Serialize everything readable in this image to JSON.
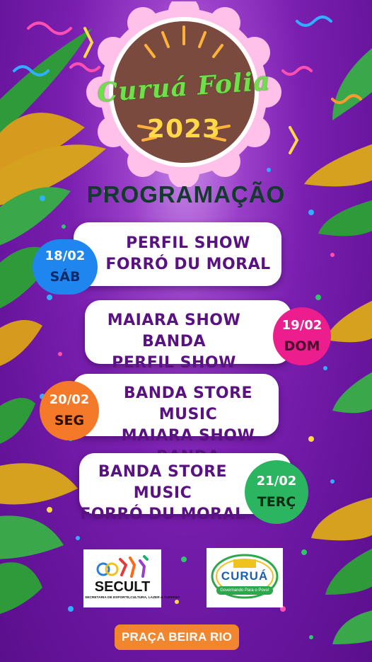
{
  "event": {
    "title": "Curuá Folia",
    "year": "2023"
  },
  "section_title": "PROGRAMAÇÃO",
  "schedule": [
    {
      "date": "18/02",
      "weekday": "SÁB",
      "lines": [
        "PERFIL SHOW",
        "FORRÓ DU MORAL"
      ],
      "color": "#1e86ee"
    },
    {
      "date": "19/02",
      "weekday": "DOM",
      "lines": [
        "MAIARA SHOW BANDA",
        "PERFIL SHOW"
      ],
      "color": "#ec1d8c"
    },
    {
      "date": "20/02",
      "weekday": "SEG",
      "lines": [
        "BANDA STORE MUSIC",
        "MAIARA SHOW BANDA"
      ],
      "color": "#f47a2a"
    },
    {
      "date": "21/02",
      "weekday": "TERÇ",
      "lines": [
        "BANDA STORE MUSIC",
        "FORRÓ DU MORAL"
      ],
      "color": "#2cb561"
    }
  ],
  "logos": {
    "secult": {
      "name": "SECULT",
      "subtitle": "SECRETARIA DE ESPORTE,CULTURA, LAZER & TURISMO"
    },
    "curua": {
      "name": "CURUÁ",
      "subtitle": "Governando Para o Povo!"
    }
  },
  "venue": "PRAÇA BEIRA RIO",
  "colors": {
    "background": "#6a16a0",
    "card_text": "#5a1282",
    "title_green": "#6ee04a",
    "year_yellow": "#ffd94a",
    "section_title": "#123b2b",
    "venue_pill": "#f2862f"
  }
}
